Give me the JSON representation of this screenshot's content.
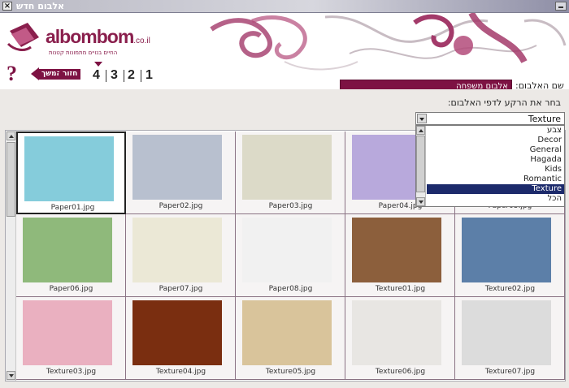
{
  "window": {
    "title": "אלבום חדש"
  },
  "logo": {
    "brand_main": "albombom",
    "brand_tld": ".co.il",
    "tagline": "החיים בנויים מתמונות קטנות"
  },
  "nav": {
    "help": "?",
    "next_label": "המשך",
    "back_label": "חזור",
    "steps": [
      "1",
      "2",
      "3",
      "4"
    ],
    "current_step": "4"
  },
  "album": {
    "label": "שם האלבום:",
    "value": "אלבום משפחה"
  },
  "background": {
    "label": "בחר את הרקע לדפי האלבום:",
    "selected": "Texture",
    "options": [
      "צבע",
      "Decor",
      "General",
      "Hagada",
      "Kids",
      "Romantic",
      "Texture",
      "הכל"
    ]
  },
  "colors": {
    "accent": "#7d1243",
    "dropdown_highlight": "#1c2a6b"
  },
  "thumbnails": [
    {
      "file": "Paper01.jpg",
      "color": "#85ccdb",
      "selected": true
    },
    {
      "file": "Paper02.jpg",
      "color": "#b8c0cf"
    },
    {
      "file": "Paper03.jpg",
      "color": "#dcdac8"
    },
    {
      "file": "Paper04.jpg",
      "color": "#b8a9dc"
    },
    {
      "file": "Paper05.jpg",
      "color": "#eef4f8"
    },
    {
      "file": "Paper06.jpg",
      "color": "#8fb97b"
    },
    {
      "file": "Paper07.jpg",
      "color": "#ebe8d6"
    },
    {
      "file": "Paper08.jpg",
      "color": "#f1f1f1"
    },
    {
      "file": "Texture01.jpg",
      "color": "#8c5f3c"
    },
    {
      "file": "Texture02.jpg",
      "color": "#5c7fa8"
    },
    {
      "file": "Texture03.jpg",
      "color": "#eab0c0"
    },
    {
      "file": "Texture04.jpg",
      "color": "#7a2e10"
    },
    {
      "file": "Texture05.jpg",
      "color": "#d9c49b"
    },
    {
      "file": "Texture06.jpg",
      "color": "#e8e6e3"
    },
    {
      "file": "Texture07.jpg",
      "color": "#dcdcdc"
    }
  ]
}
